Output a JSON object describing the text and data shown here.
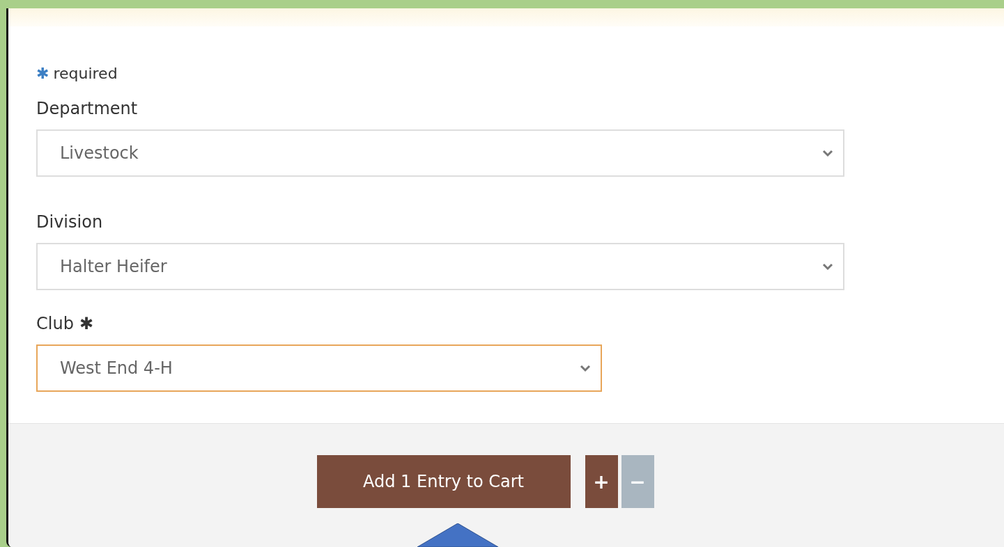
{
  "required_note": {
    "marker": "✱",
    "text": "required"
  },
  "fields": [
    {
      "label": "Department",
      "value": "Livestock",
      "required": false,
      "focused": false,
      "wide": true
    },
    {
      "label": "Division",
      "value": "Halter Heifer",
      "required": false,
      "focused": false,
      "wide": true
    },
    {
      "label": "Club",
      "value": "West End 4-H",
      "required": true,
      "focused": true,
      "wide": false
    }
  ],
  "actions": {
    "add_label": "Add 1 Entry to Cart",
    "plus": {
      "label": "+",
      "disabled": false
    },
    "minus": {
      "label": "−",
      "disabled": true
    }
  }
}
